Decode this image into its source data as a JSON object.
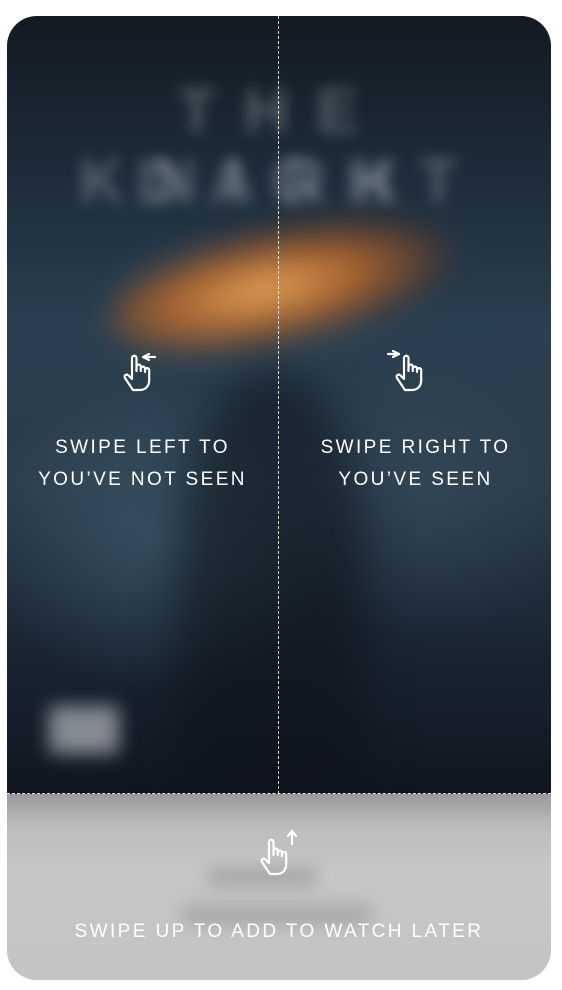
{
  "poster": {
    "title_line1": "THE DARK",
    "title_line2": "KNIGHT"
  },
  "hints": {
    "left": {
      "icon": "swipe-left-hand-icon",
      "line1": "SWIPE LEFT TO",
      "line2": "YOU’VE NOT SEEN"
    },
    "right": {
      "icon": "swipe-right-hand-icon",
      "line1": "SWIPE RIGHT TO",
      "line2": "YOU’VE SEEN"
    },
    "up": {
      "icon": "swipe-up-hand-icon",
      "line1": "SWIPE UP TO ADD TO WATCH LATER"
    }
  },
  "colors": {
    "overlay_text": "#ffffff",
    "bottom_panel": "#c6c6c6"
  }
}
